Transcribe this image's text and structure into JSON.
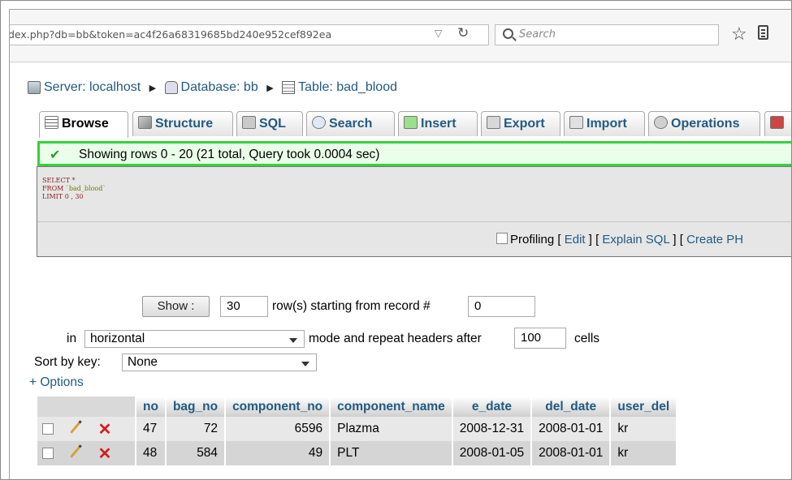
{
  "browser": {
    "url": "dex.php?db=bb&token=ac4f26a68319685bd240e952cef892ea",
    "search_placeholder": "Search"
  },
  "breadcrumb": {
    "server": "Server: localhost",
    "database": "Database: bb",
    "table": "Table: bad_blood"
  },
  "tabs": [
    {
      "label": "Browse"
    },
    {
      "label": "Structure"
    },
    {
      "label": "SQL"
    },
    {
      "label": "Search"
    },
    {
      "label": "Insert"
    },
    {
      "label": "Export"
    },
    {
      "label": "Import"
    },
    {
      "label": "Operations"
    }
  ],
  "message": "Showing rows 0 - 20 (21 total, Query took 0.0004 sec)",
  "sql": {
    "line1": "SELECT *",
    "line2_kw": "FROM ",
    "line2_str": "`bad_blood`",
    "line3": "LIMIT 0 , 30",
    "profiling": "Profiling",
    "edit": "Edit",
    "explain": "Explain SQL",
    "create": "Create PH"
  },
  "nav_form": {
    "show_label": "Show :",
    "rows_value": "30",
    "rows_text": "row(s) starting from record #",
    "start_value": "0",
    "in_label": "in",
    "mode_value": "horizontal",
    "mode_text": "mode and repeat headers after",
    "repeat_value": "100",
    "cells_text": "cells",
    "sort_label": "Sort by key:",
    "sort_value": "None",
    "options_link": "+ Options"
  },
  "table": {
    "columns": [
      "no",
      "bag_no",
      "component_no",
      "component_name",
      "e_date",
      "del_date",
      "user_del"
    ],
    "rows": [
      {
        "no": "47",
        "bag_no": "72",
        "component_no": "6596",
        "component_name": "Plazma",
        "e_date": "2008-12-31",
        "del_date": "2008-01-01",
        "user_del": "kr"
      },
      {
        "no": "48",
        "bag_no": "584",
        "component_no": "49",
        "component_name": "PLT",
        "e_date": "2008-01-05",
        "del_date": "2008-01-01",
        "user_del": "kr"
      }
    ]
  }
}
